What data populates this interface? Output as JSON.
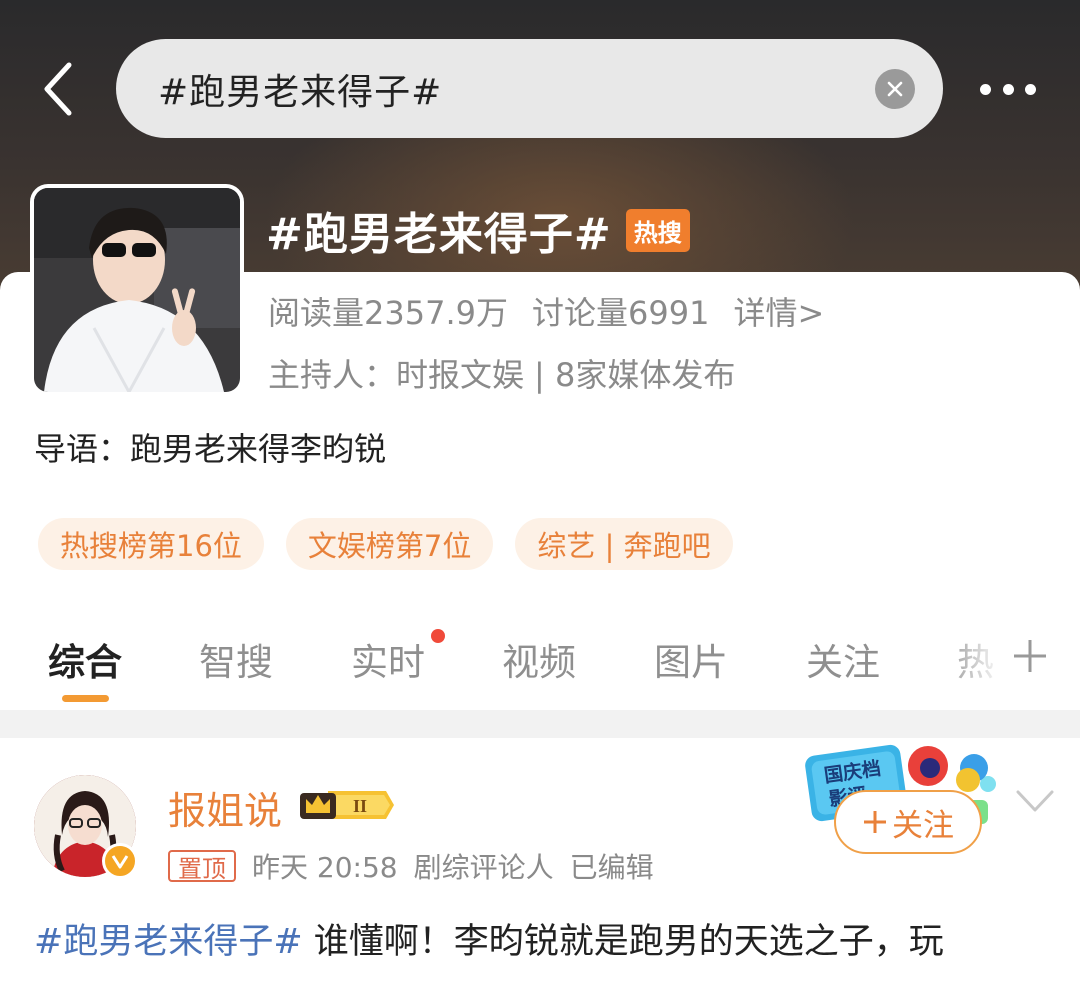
{
  "header": {
    "search_value": "#跑男老来得子#"
  },
  "topic": {
    "title": "#跑男老来得子#",
    "hot_badge": "热搜",
    "reads": "阅读量2357.9万",
    "discussions": "讨论量6991",
    "details_link": "详情>",
    "host_prefix": "主持人：",
    "host_name": "时报文娱",
    "media_count": "| 8家媒体发布",
    "intro": "导语：跑男老来得李昀锐"
  },
  "tags": [
    {
      "label": "热搜榜第16位"
    },
    {
      "label": "文娱榜第7位"
    },
    {
      "label": "综艺 | 奔跑吧"
    }
  ],
  "tabs": [
    {
      "label": "综合"
    },
    {
      "label": "智搜"
    },
    {
      "label": "实时"
    },
    {
      "label": "视频"
    },
    {
      "label": "图片"
    },
    {
      "label": "关注"
    },
    {
      "label": "热"
    }
  ],
  "post": {
    "username": "报姐说",
    "rank_label": "II",
    "pin_label": "置顶",
    "time": "昨天 20:58",
    "role": "剧综评论人",
    "edited": "已编辑",
    "follow_label": "关注",
    "activity_label": "国庆档影评",
    "hashtag": "#跑男老来得子#",
    "text": " 谁懂啊！李昀锐就是跑男的天选之子，玩"
  },
  "colors": {
    "accent_orange": "#e8813a",
    "hot_badge": "#f07e2d",
    "hashtag_blue": "#4a73b8",
    "tab_indicator": "#f39a33",
    "red_dot": "#f04a3a"
  },
  "icons": {
    "back": "chevron-left-icon",
    "clear": "close-icon",
    "more": "more-dots-icon",
    "add_tab": "plus-icon",
    "expand": "chevron-down-icon",
    "verified": "verified-v-icon",
    "crown": "crown-icon"
  }
}
